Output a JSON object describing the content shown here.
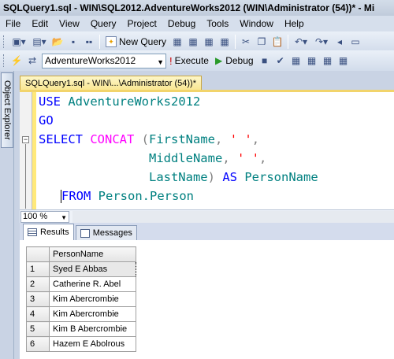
{
  "window": {
    "title": "SQLQuery1.sql - WIN\\SQL2012.AdventureWorks2012 (WIN\\Administrator (54))* - Mi"
  },
  "menu": [
    "File",
    "Edit",
    "View",
    "Query",
    "Project",
    "Debug",
    "Tools",
    "Window",
    "Help"
  ],
  "toolbar": {
    "new_query_label": "New Query",
    "database_selected": "AdventureWorks2012",
    "execute_label": "Execute",
    "debug_label": "Debug"
  },
  "sidebar": {
    "object_explorer_label": "Object Explorer"
  },
  "document": {
    "tab_label": "SQLQuery1.sql - WIN\\...\\Administrator (54))*"
  },
  "editor": {
    "line1_kw": "USE",
    "line1_id": "AdventureWorks2012",
    "line2_kw": "GO",
    "line3_kw": "SELECT",
    "line3_fn": "CONCAT",
    "line3_paren": " (",
    "line3_col": "FirstName",
    "line3_comma": ", ",
    "line3_str": "' '",
    "line3_end": ",",
    "line4_col": "MiddleName",
    "line4_comma": ", ",
    "line4_str": "' '",
    "line4_end": ",",
    "line5_col": "LastName",
    "line5_paren": ") ",
    "line5_kw": "AS",
    "line5_alias": "PersonName",
    "line6_kw": "FROM",
    "line6_table": "Person.Person"
  },
  "zoom": {
    "value": "100 %"
  },
  "results": {
    "tabs": {
      "results_label": "Results",
      "messages_label": "Messages"
    },
    "column_header": "PersonName",
    "rows": [
      {
        "num": "1",
        "value": "Syed E Abbas"
      },
      {
        "num": "2",
        "value": "Catherine R. Abel"
      },
      {
        "num": "3",
        "value": "Kim  Abercrombie"
      },
      {
        "num": "4",
        "value": "Kim  Abercrombie"
      },
      {
        "num": "5",
        "value": "Kim B Abercrombie"
      },
      {
        "num": "6",
        "value": "Hazem E Abolrous"
      }
    ]
  }
}
